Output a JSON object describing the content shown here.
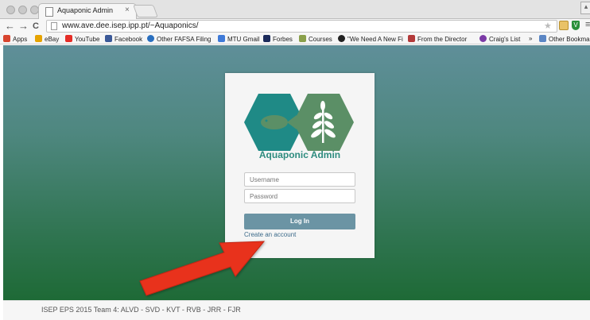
{
  "browser": {
    "tab_title": "Aquaponic Admin",
    "tab_close": "×",
    "url": "www.ave.dee.isep.ipp.pt/~Aquaponics/",
    "nav": {
      "back": "←",
      "forward": "→",
      "reload": "C"
    },
    "menu": "≡",
    "shield_letter": "V",
    "bookmarks": [
      {
        "label": "Apps",
        "color": "#d8452f"
      },
      {
        "label": "eBay",
        "color": "#e6a300"
      },
      {
        "label": "YouTube",
        "color": "#e52d27"
      },
      {
        "label": "Facebook",
        "color": "#3b5998"
      },
      {
        "label": "Other FAFSA Filing",
        "color": "#2a6fbf"
      },
      {
        "label": "MTU Gmail",
        "color": "#3f7ad8"
      },
      {
        "label": "Forbes",
        "color": "#1c2b5b"
      },
      {
        "label": "Courses",
        "color": "#8aa04b"
      },
      {
        "label": "\"We Need A New Fi",
        "color": "#222222"
      },
      {
        "label": "From the Director",
        "color": "#b33a3a"
      },
      {
        "label": "Craig's List",
        "color": "#7b3aa6"
      },
      {
        "label": "»",
        "color": ""
      },
      {
        "label": "Other Bookmarks",
        "color": "#5b86c4"
      }
    ]
  },
  "login": {
    "app_name": "Aquaponic Admin",
    "username_placeholder": "Username",
    "password_placeholder": "Password",
    "login_label": "Log In",
    "create_account_label": "Create an account"
  },
  "footer": {
    "text": "ISEP EPS 2015 Team 4: ALVD - SVD - KVT - RVB - JRR - FJR"
  },
  "colors": {
    "arrow": "#e8321e",
    "logo_teal": "#1f8a86",
    "logo_green": "#5b8f66",
    "login_button": "#6b94a4"
  }
}
